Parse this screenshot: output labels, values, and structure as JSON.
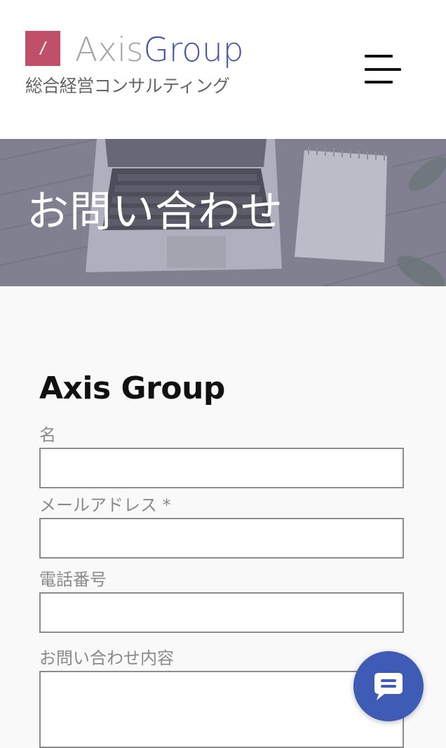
{
  "header": {
    "logo_mark": "/",
    "brand_part1": "Axis",
    "brand_part2": "Group",
    "tagline": "総合経営コンサルティング",
    "menu_icon": "hamburger-menu-icon"
  },
  "hero": {
    "title": "お問い合わせ"
  },
  "form": {
    "title": "Axis Group",
    "fields": [
      {
        "label": "名",
        "value": "",
        "placeholder": ""
      },
      {
        "label": "メールアドレス *",
        "value": "",
        "placeholder": ""
      },
      {
        "label": "電話番号",
        "value": "",
        "placeholder": ""
      },
      {
        "label": "お問い合わせ内容",
        "value": "",
        "placeholder": ""
      }
    ]
  },
  "chat": {
    "icon": "chat-bubble-icon"
  },
  "colors": {
    "brand_accent": "#c0506a",
    "brand_blue": "#4557a8",
    "chat_button": "#3e5bb5"
  }
}
